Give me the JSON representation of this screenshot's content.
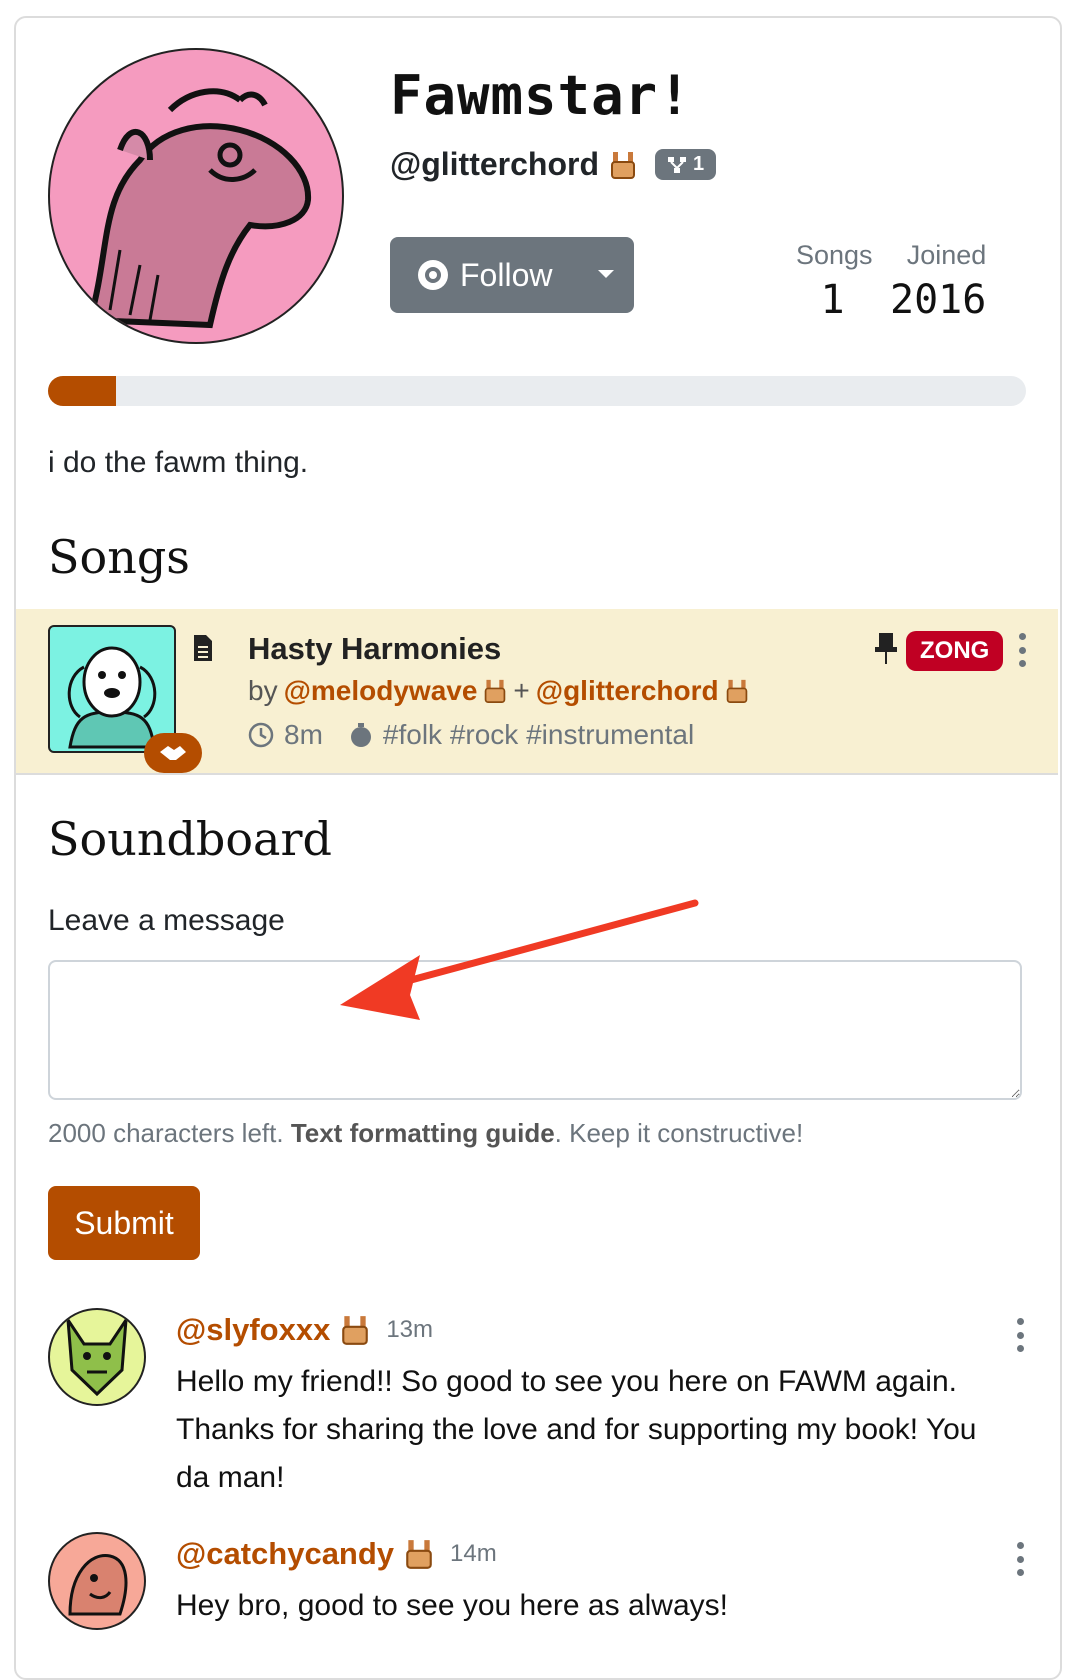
{
  "profile": {
    "name": "Fawmstar!",
    "handle": "@glitterchord",
    "collab_count": "1",
    "follow_label": "Follow",
    "stats": {
      "songs_label": "Songs",
      "songs_value": "1",
      "joined_label": "Joined",
      "joined_value": "2016"
    },
    "progress_fraction": 0.07,
    "bio": "i do the fawm thing."
  },
  "songs": {
    "heading": "Songs",
    "items": [
      {
        "title": "Hasty Harmonies",
        "by_label": "by",
        "author1": "@melodywave",
        "plus": "+",
        "author2": "@glitterchord",
        "duration": "8m",
        "tags": "#folk #rock #instrumental",
        "badge": "ZONG"
      }
    ]
  },
  "soundboard": {
    "heading": "Soundboard",
    "leave_label": "Leave a message",
    "message_value": "",
    "chars_left": "2000 characters left. ",
    "guide_link": "Text formatting guide",
    "guide_suffix": ". Keep it constructive!",
    "submit_label": "Submit"
  },
  "comments": [
    {
      "user": "@slyfoxxx",
      "time": "13m",
      "text": "Hello my friend!! So good to see you here on FAWM again. Thanks for sharing the love and for supporting my book! You da man!"
    },
    {
      "user": "@catchycandy",
      "time": "14m",
      "text": "Hey bro, good to see you here as always!"
    }
  ],
  "colors": {
    "accent": "#b44d00",
    "secondary": "#6c757d",
    "song_row_bg": "#f8f0d2",
    "zong_red": "#c00023",
    "annotation_arrow": "#f03a24"
  }
}
